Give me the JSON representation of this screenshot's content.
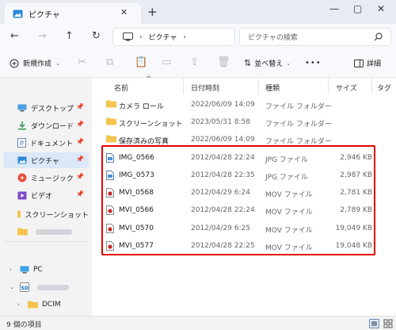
{
  "window": {
    "tab_title": "ピクチャ"
  },
  "address": {
    "segment": "ピクチャ",
    "search_placeholder": "ピクチャの検索"
  },
  "toolbar": {
    "new_label": "新規作成",
    "sort_label": "並べ替え",
    "more": "•••",
    "details_label": "詳細"
  },
  "columns": {
    "name": "名前",
    "date": "日付時刻",
    "type": "種類",
    "size": "サイズ",
    "tag": "タグ"
  },
  "files": [
    {
      "name": "カメラ ロール",
      "date": "2022/06/09 14:09",
      "type": "ファイル フォルダー",
      "size": "",
      "icon": "folder-icon"
    },
    {
      "name": "スクリーンショット",
      "date": "2023/05/31 8:58",
      "type": "ファイル フォルダー",
      "size": "",
      "icon": "folder-icon"
    },
    {
      "name": "保存済みの写真",
      "date": "2022/06/09 14:09",
      "type": "ファイル フォルダー",
      "size": "",
      "icon": "folder-icon"
    },
    {
      "name": "IMG_0566",
      "date": "2012/04/28 22:24",
      "type": "JPG ファイル",
      "size": "2,946 KB",
      "icon": "jpg-file-icon"
    },
    {
      "name": "IMG_0573",
      "date": "2012/04/28 22:35",
      "type": "JPG ファイル",
      "size": "2,987 KB",
      "icon": "jpg-file-icon"
    },
    {
      "name": "MVI_0568",
      "date": "2012/04/29 6:24",
      "type": "MOV ファイル",
      "size": "2,781 KB",
      "icon": "mov-file-icon"
    },
    {
      "name": "MVI_0566",
      "date": "2012/04/28 22:24",
      "type": "MOV ファイル",
      "size": "2,789 KB",
      "icon": "mov-file-icon"
    },
    {
      "name": "MVI_0570",
      "date": "2012/04/29 6:25",
      "type": "MOV ファイル",
      "size": "19,049 KB",
      "icon": "mov-file-icon"
    },
    {
      "name": "MVI_0577",
      "date": "2012/04/28 22:25",
      "type": "MOV ファイル",
      "size": "19,048 KB",
      "icon": "mov-file-icon"
    }
  ],
  "sidebar": [
    {
      "label": "デスクトップ",
      "icon": "desktop-icon",
      "pinned": true
    },
    {
      "label": "ダウンロード",
      "icon": "download-icon",
      "pinned": true
    },
    {
      "label": "ドキュメント",
      "icon": "document-icon",
      "pinned": true
    },
    {
      "label": "ピクチャ",
      "icon": "pictures-icon",
      "pinned": true,
      "selected": true
    },
    {
      "label": "ミュージック",
      "icon": "music-icon",
      "pinned": true
    },
    {
      "label": "ビデオ",
      "icon": "video-icon",
      "pinned": true
    },
    {
      "label": "スクリーンショット",
      "icon": "folder-icon",
      "pinned": false
    },
    {
      "label": "",
      "icon": "folder-icon",
      "pinned": false
    },
    {
      "label": "PC",
      "icon": "pc-icon",
      "pinned": false
    },
    {
      "label": "",
      "icon": "sd-card-icon",
      "pinned": false
    },
    {
      "label": "DCIM",
      "icon": "folder-icon",
      "pinned": false
    }
  ],
  "status": {
    "item_count": "9 個の項目"
  },
  "colors": {
    "accent": "#0067c0",
    "highlight": "#e40000",
    "folder": "#f4c44e",
    "selected": "#dce8f7"
  }
}
